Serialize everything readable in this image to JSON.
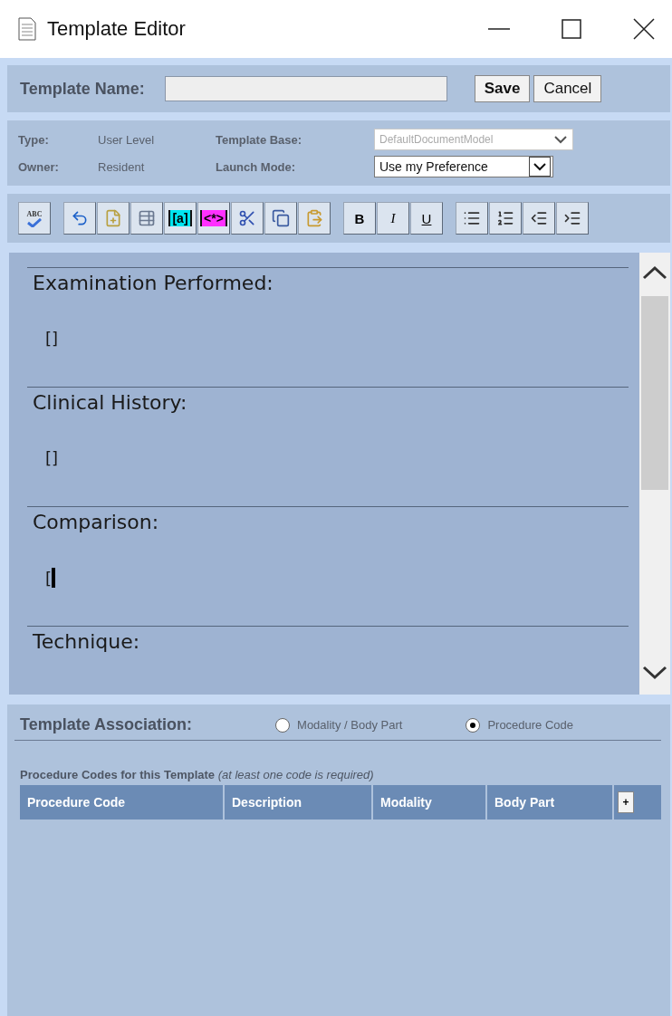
{
  "window": {
    "title": "Template Editor"
  },
  "name_bar": {
    "label": "Template Name:",
    "buttons": [
      {
        "label": "Save",
        "kind": "primary"
      },
      {
        "label": "Cancel",
        "kind": "normal"
      }
    ]
  },
  "info": {
    "rows": [
      {
        "label": "Type:",
        "value": "User Level",
        "field_label": "Template Base:",
        "select": "DefaultDocumentModel",
        "disabled": true
      },
      {
        "label": "Owner:",
        "value": "Resident",
        "field_label": "Launch Mode:",
        "select": "Use my Preference",
        "disabled": false
      }
    ]
  },
  "toolbar": [
    [
      {
        "kind": "spellcheck",
        "label": "ABC"
      }
    ],
    [
      {
        "kind": "undo"
      },
      {
        "kind": "new"
      },
      {
        "kind": "field"
      },
      {
        "kind": "tag",
        "label": "[a]",
        "color": "#00e5ef"
      },
      {
        "kind": "tag",
        "label": "<*>",
        "color": "#ff30ff"
      },
      {
        "kind": "cut"
      },
      {
        "kind": "copy"
      },
      {
        "kind": "paste"
      }
    ],
    [
      {
        "kind": "bold",
        "label": "B"
      },
      {
        "kind": "italic",
        "label": "I"
      },
      {
        "kind": "underline",
        "label": "U"
      }
    ],
    [
      {
        "kind": "bullets"
      },
      {
        "kind": "numbers"
      },
      {
        "kind": "outdent"
      },
      {
        "kind": "indent"
      }
    ]
  ],
  "editor": {
    "sections": [
      {
        "heading": "Examination Performed:",
        "body": "[]",
        "cursor": false
      },
      {
        "heading": "Clinical History:",
        "body": "[]",
        "cursor": false
      },
      {
        "heading": "Comparison:",
        "body": "[",
        "cursor": true
      },
      {
        "heading": "Technique:",
        "cursor": false
      }
    ]
  },
  "association": {
    "label": "Template Association:",
    "options": [
      {
        "label": "Modality / Body Part",
        "selected": false
      },
      {
        "label": "Procedure Code",
        "selected": true
      }
    ],
    "table_title": "Procedure Codes for this Template",
    "table_note": "(at least one code is required)",
    "columns": [
      "Procedure Code",
      "Description",
      "Modality",
      "Body Part"
    ],
    "add_button": "+"
  }
}
